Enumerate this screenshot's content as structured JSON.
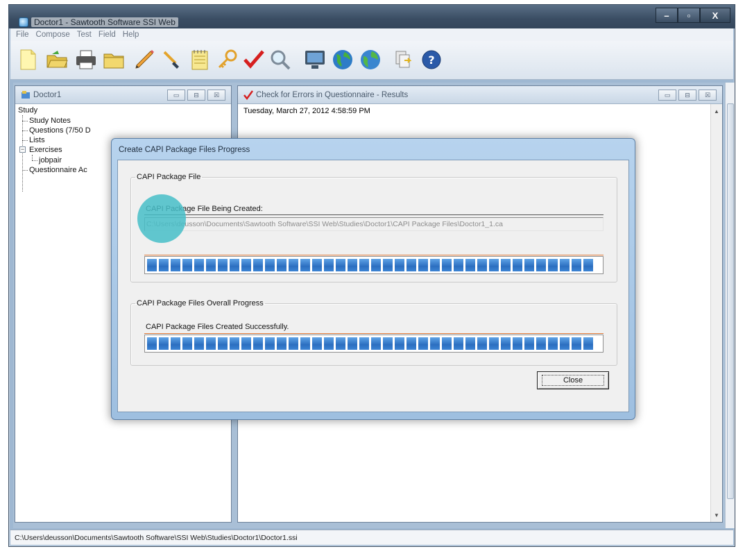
{
  "app": {
    "title": "Doctor1 - Sawtooth Software SSI Web",
    "window_controls": {
      "minimize": "–",
      "maximize": "▫",
      "close": "X"
    }
  },
  "menu": [
    "File",
    "Compose",
    "Test",
    "Field",
    "Help"
  ],
  "toolbar_icons": [
    "new-file-icon",
    "open-folder-icon",
    "print-icon",
    "folder-icon",
    "pencil-icon",
    "brush-icon",
    "notepad-icon",
    "key-icon",
    "checkmark-icon",
    "magnifier-icon",
    "monitor-icon",
    "globe-icon",
    "globe-2-icon",
    "copy-arrow-icon",
    "help-icon"
  ],
  "study_window": {
    "title": "Doctor1",
    "tree": {
      "root": "Study",
      "items": [
        "Study Notes",
        "Questions (7/50 D",
        "Lists",
        "Exercises",
        "jobpair",
        "Questionnaire Ac"
      ]
    }
  },
  "results_window": {
    "title": "Check for Errors in Questionnaire - Results",
    "timestamp": "Tuesday, March 27, 2012  4:58:59 PM"
  },
  "dialog": {
    "title": "Create CAPI Package Files Progress",
    "group1": {
      "legend": "CAPI Package File",
      "label": "CAPI Package File Being Created:",
      "path": "C:\\Users\\deusson\\Documents\\Sawtooth Software\\SSI Web\\Studies\\Doctor1\\CAPI Package Files\\Doctor1_1.ca",
      "progress": 1.0
    },
    "group2": {
      "legend": "CAPI Package Files Overall Progress",
      "label": "CAPI Package Files Created Successfully.",
      "progress": 1.0
    },
    "close_button": "Close"
  },
  "status_bar": "C:\\Users\\deusson\\Documents\\Sawtooth Software\\SSI Web\\Studies\\Doctor1\\Doctor1.ssi"
}
